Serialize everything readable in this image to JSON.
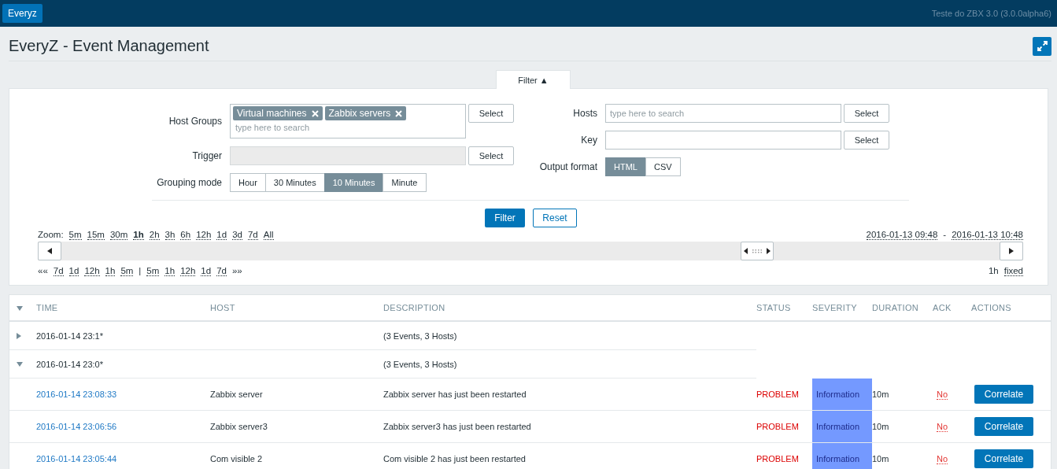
{
  "topbar": {
    "app_button": "Everyz",
    "server_info": "Teste do ZBX 3.0 (3.0.0alpha6)"
  },
  "page": {
    "title": "EveryZ - Event Management"
  },
  "filter": {
    "tab": "Filter ▲",
    "expanded": true,
    "host_groups": {
      "label": "Host Groups",
      "tags": [
        "Virtual machines",
        "Zabbix servers"
      ],
      "placeholder": "type here to search",
      "button": "Select"
    },
    "trigger": {
      "label": "Trigger",
      "disabled": true,
      "button": "Select"
    },
    "grouping_mode": {
      "label": "Grouping mode",
      "options": [
        {
          "label": "Hour",
          "selected": false
        },
        {
          "label": "30 Minutes",
          "selected": false
        },
        {
          "label": "10 Minutes",
          "selected": true
        },
        {
          "label": "Minute",
          "selected": false
        }
      ]
    },
    "hosts": {
      "label": "Hosts",
      "placeholder": "type here to search",
      "button": "Select"
    },
    "key": {
      "label": "Key",
      "button": "Select"
    },
    "output_format": {
      "label": "Output format",
      "options": [
        {
          "label": "HTML",
          "selected": true
        },
        {
          "label": "CSV",
          "selected": false
        }
      ]
    },
    "buttons": {
      "apply": "Filter",
      "reset": "Reset"
    }
  },
  "timeline": {
    "zoom_label": "Zoom:",
    "zoom": [
      {
        "label": "5m",
        "selected": false
      },
      {
        "label": "15m",
        "selected": false
      },
      {
        "label": "30m",
        "selected": false
      },
      {
        "label": "1h",
        "selected": true
      },
      {
        "label": "2h",
        "selected": false
      },
      {
        "label": "3h",
        "selected": false
      },
      {
        "label": "6h",
        "selected": false
      },
      {
        "label": "12h",
        "selected": false
      },
      {
        "label": "1d",
        "selected": false
      },
      {
        "label": "3d",
        "selected": false
      },
      {
        "label": "7d",
        "selected": false
      },
      {
        "label": "All",
        "selected": false
      }
    ],
    "period_from": "2016-01-13 09:48",
    "period_sep": "-",
    "period_to": "2016-01-13 10:48",
    "nav": [
      {
        "kind": "arrow",
        "label": "««"
      },
      {
        "kind": "link",
        "label": "7d"
      },
      {
        "kind": "link",
        "label": "1d"
      },
      {
        "kind": "link",
        "label": "12h"
      },
      {
        "kind": "link",
        "label": "1h"
      },
      {
        "kind": "link",
        "label": "5m"
      },
      {
        "kind": "separator",
        "label": "|"
      },
      {
        "kind": "link",
        "label": "5m"
      },
      {
        "kind": "link",
        "label": "1h"
      },
      {
        "kind": "link",
        "label": "12h"
      },
      {
        "kind": "link",
        "label": "1d"
      },
      {
        "kind": "link",
        "label": "7d"
      },
      {
        "kind": "arrow",
        "label": "»»"
      }
    ],
    "period_length": "1h",
    "fixed": "fixed"
  },
  "table": {
    "columns": [
      "TIME",
      "HOST",
      "DESCRIPTION",
      "STATUS",
      "SEVERITY",
      "DURATION",
      "ACK",
      "ACTIONS"
    ],
    "rows": [
      {
        "kind": "group",
        "expanded": false,
        "time": "2016-01-14 23:1*",
        "description": "(3 Events, 3 Hosts)"
      },
      {
        "kind": "group",
        "expanded": true,
        "time": "2016-01-14 23:0*",
        "description": "(3 Events, 3 Hosts)"
      },
      {
        "kind": "event",
        "time": "2016-01-14 23:08:33",
        "host": "Zabbix server",
        "description": "Zabbix server has just been restarted",
        "status": "PROBLEM",
        "severity": "Information",
        "color": "#7499ff",
        "duration": "10m",
        "ack": "No",
        "action": "Correlate"
      },
      {
        "kind": "event",
        "time": "2016-01-14 23:06:56",
        "host": "Zabbix server3",
        "description": "Zabbix server3 has just been restarted",
        "status": "PROBLEM",
        "severity": "Information",
        "color": "#7499ff",
        "duration": "10m",
        "ack": "No",
        "action": "Correlate"
      },
      {
        "kind": "event",
        "time": "2016-01-14 23:05:44",
        "host": "Com visible 2",
        "description": "Com visible 2 has just been restarted",
        "status": "PROBLEM",
        "severity": "Information",
        "color": "#7499ff",
        "duration": "10m",
        "ack": "No",
        "action": "Correlate"
      }
    ]
  }
}
